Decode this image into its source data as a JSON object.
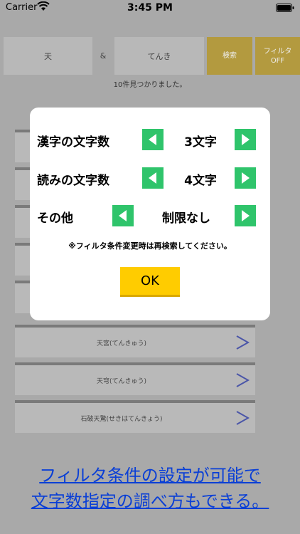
{
  "status_bar": {
    "carrier": "Carrier",
    "time": "3:45 PM"
  },
  "search": {
    "kanji_value": "天",
    "amp": "&",
    "reading_value": "てんき",
    "search_label": "検索",
    "filter_label_line1": "フィルタ",
    "filter_label_line2": "OFF"
  },
  "result_count": "10件見つかりました。",
  "list": {
    "rows": [
      {
        "label": ""
      },
      {
        "label": ""
      },
      {
        "label": ""
      },
      {
        "label": ""
      },
      {
        "label": ""
      },
      {
        "label": "天宮(てんきゅう)"
      },
      {
        "label": "天穹(てんきゅう)"
      },
      {
        "label": "石破天驚(せきはてんきょう)"
      }
    ]
  },
  "dialog": {
    "kanji_count_label": "漢字の文字数",
    "kanji_count_value": "3文字",
    "reading_count_label": "読みの文字数",
    "reading_count_value": "4文字",
    "other_label": "その他",
    "other_value": "制限なし",
    "note": "※フィルタ条件変更時は再検索してください。",
    "ok_label": "OK"
  },
  "promo": {
    "line1": "フィルタ条件の設定が可能で",
    "line2": "文字数指定の調べ方もできる。"
  },
  "colors": {
    "accent_green": "#2fc46b",
    "ok_yellow": "#ffcc00",
    "promo_blue": "#0a3fd6",
    "gold_button": "#b39a3f"
  }
}
